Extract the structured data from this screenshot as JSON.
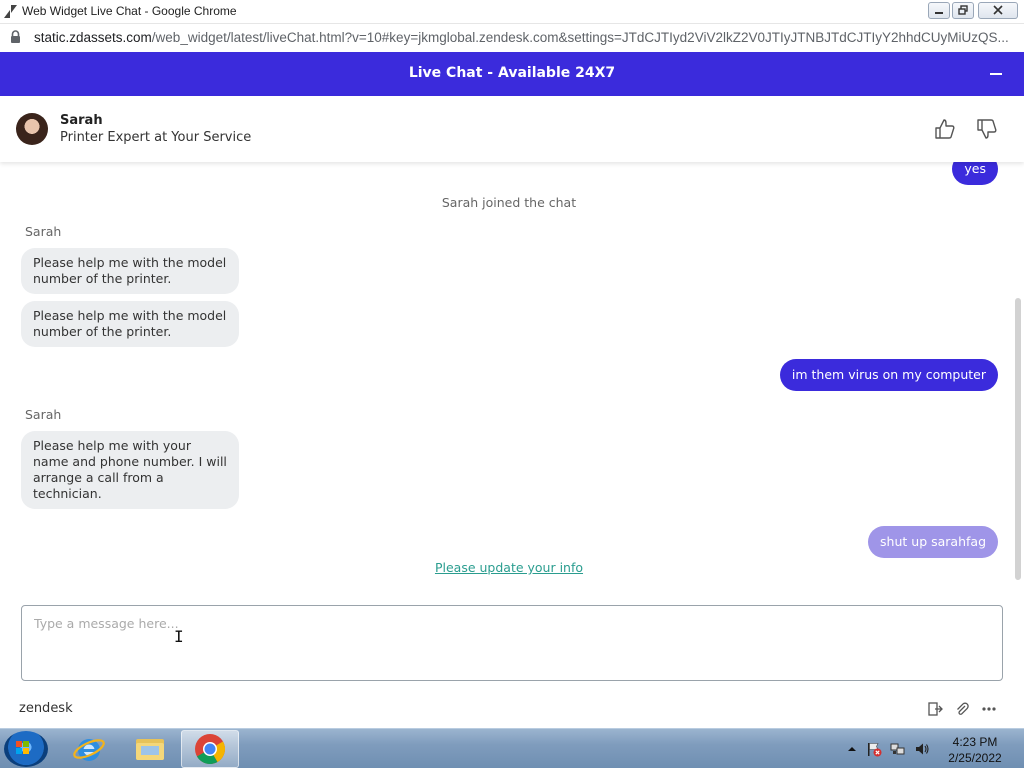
{
  "window": {
    "title": "Web Widget Live Chat - Google Chrome",
    "url_host": "static.zdassets.com",
    "url_rest": "/web_widget/latest/liveChat.html?v=10#key=jkmglobal.zendesk.com&settings=JTdCJTIyd2ViV2lkZ2V0JTIyJTNBJTdCJTIyY2hhdCUyMiUzQS..."
  },
  "widget": {
    "header_title": "Live Chat - Available 24X7",
    "agent_name": "Sarah",
    "agent_title": "Printer Expert at Your Service"
  },
  "messages": {
    "out_yes": "yes",
    "system_joined": "Sarah joined the chat",
    "sender_1": "Sarah",
    "in_1": "Please help me with the model number of the printer.",
    "in_2": "Please help me with the model number of the printer.",
    "out_virus": "im them virus on my computer",
    "sender_2": "Sarah",
    "in_3": "Please help me with your name and phone number. I will arrange a call from a technician.",
    "out_pending": "shut up sarahfag",
    "update_link": "Please update your info"
  },
  "composer": {
    "placeholder": "Type a message here..."
  },
  "footer": {
    "brand": "zendesk"
  },
  "taskbar": {
    "time": "4:23 PM",
    "date": "2/25/2022"
  },
  "colors": {
    "accent": "#3b2bdc",
    "pending_bubble": "#9f95e8",
    "link": "#2a9d8f"
  }
}
